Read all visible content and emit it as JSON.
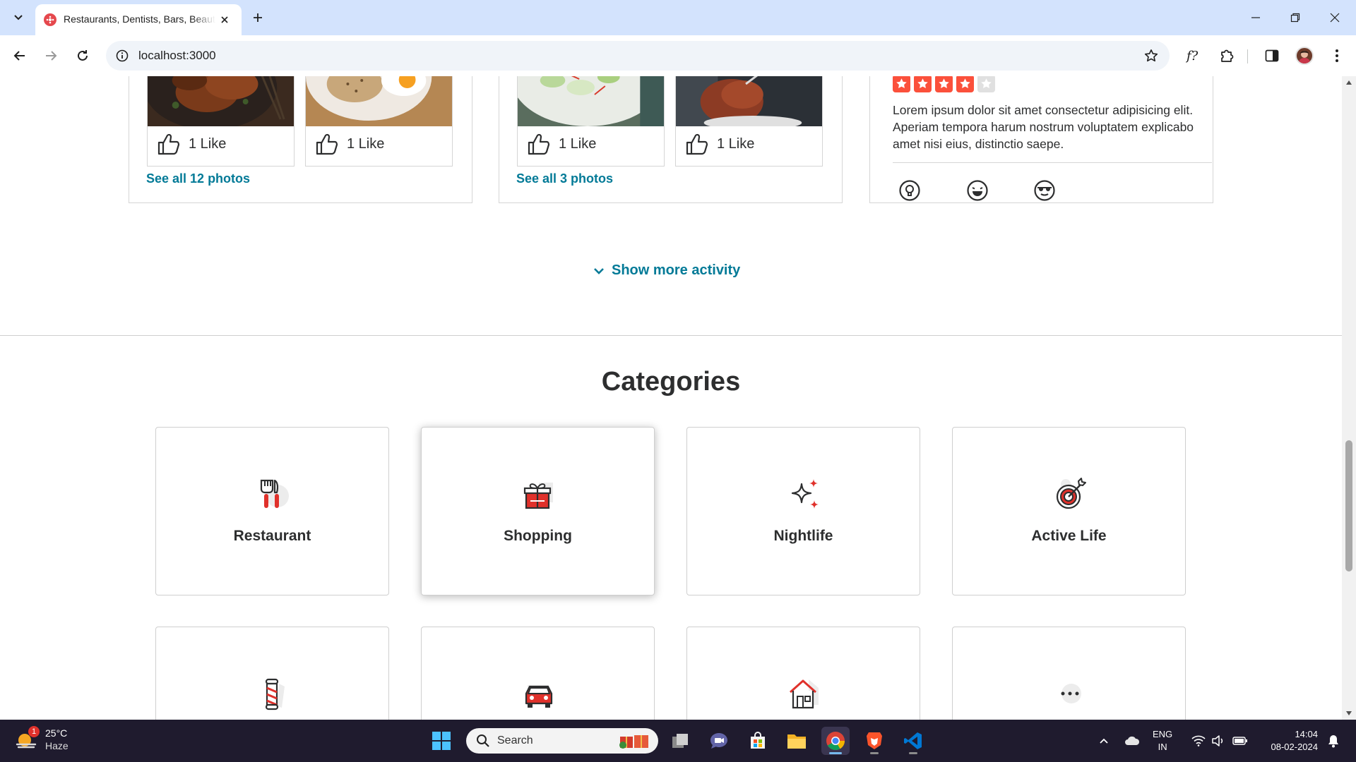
{
  "browser": {
    "tab_title": "Restaurants, Dentists, Bars, Beauty Salons",
    "url": "localhost:3000"
  },
  "activity": {
    "cards": [
      {
        "photos": [
          {
            "likes": "1 Like"
          },
          {
            "likes": "1 Like"
          }
        ],
        "see_all": "See all 12 photos"
      },
      {
        "photos": [
          {
            "likes": "1 Like"
          },
          {
            "likes": "1 Like"
          }
        ],
        "see_all": "See all 3 photos"
      }
    ],
    "review": {
      "rating": 4,
      "max_rating": 5,
      "text": "Lorem ipsum dolor sit amet consectetur adipisicing elit. Aperiam tempora harum nostrum voluptatem explicabo amet nisi eius, distinctio saepe.",
      "reactions": [
        "lightbulb-icon",
        "laughing-face-icon",
        "sunglasses-face-icon"
      ]
    },
    "show_more": "Show more activity"
  },
  "categories": {
    "title": "Categories",
    "items": [
      {
        "label": "Restaurant",
        "icon": "restaurant-icon"
      },
      {
        "label": "Shopping",
        "icon": "shopping-gift-icon"
      },
      {
        "label": "Nightlife",
        "icon": "nightlife-sparkle-icon"
      },
      {
        "label": "Active Life",
        "icon": "active-life-target-icon"
      },
      {
        "label": "",
        "icon": "barber-pole-icon"
      },
      {
        "label": "",
        "icon": "car-icon"
      },
      {
        "label": "",
        "icon": "home-services-icon"
      },
      {
        "label": "",
        "icon": "more-dots-icon"
      }
    ]
  },
  "taskbar": {
    "weather": {
      "temp": "25°C",
      "condition": "Haze",
      "badge": "1"
    },
    "search_placeholder": "Search",
    "language": {
      "line1": "ENG",
      "line2": "IN"
    },
    "clock": {
      "time": "14:04",
      "date": "08-02-2024"
    }
  },
  "colors": {
    "accent_link": "#027a97",
    "star_red": "#fb503b",
    "icon_red": "#e0312b"
  }
}
